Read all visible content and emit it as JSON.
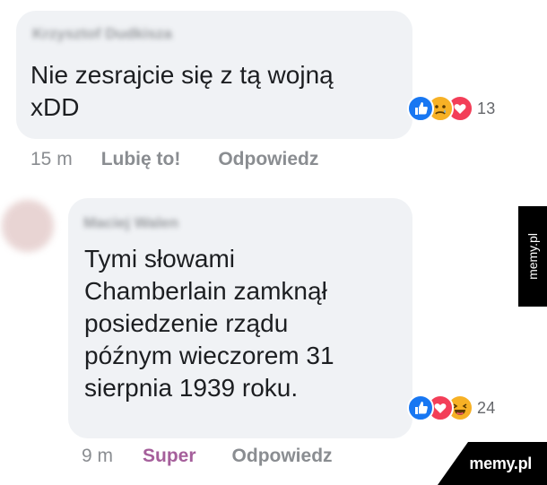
{
  "comment1": {
    "author": "Krzysztof Dudkisza",
    "text_before": "Nie ze",
    "text_highlight": "sra",
    "text_after": "jcie się z tą wojną\nxDD",
    "reactions": {
      "icons": [
        "like-icon",
        "sad-icon",
        "love-icon"
      ],
      "count": "13"
    },
    "time": "15 m",
    "like_label": "Lubię to!",
    "reply_label": "Odpowiedz"
  },
  "comment2": {
    "author": "Maciej Walen",
    "text": "Tymi słowami\nChamberlain zamknął\nposiedzenie rządu\npóźnym wieczorem 31\nsierpnia 1939 roku.",
    "reactions": {
      "icons": [
        "like-icon",
        "love-icon",
        "haha-icon"
      ],
      "count": "24"
    },
    "time": "9 m",
    "like_label": "Super",
    "reply_label": "Odpowiedz"
  },
  "watermark": {
    "side_label": "memy.pl",
    "corner_label": "memy.pl"
  },
  "colors": {
    "bubble": "#f0f2f5",
    "text": "#1c1e21",
    "meta": "#8a8d91",
    "super": "#a55f9b",
    "like": "#1877f2",
    "love": "#f33e58",
    "sad_haha": "#f7b125",
    "highlight": "#72c7f3"
  }
}
